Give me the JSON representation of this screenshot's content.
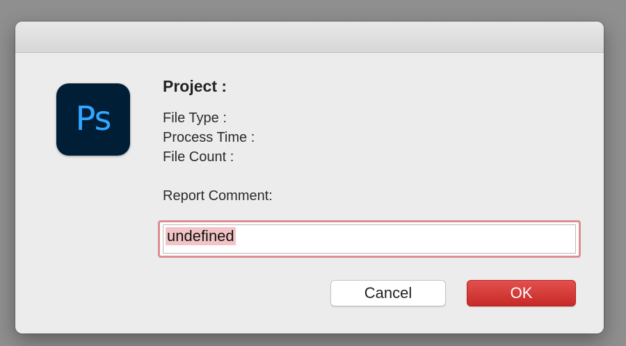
{
  "app": {
    "icon_name": "photoshop-app-icon",
    "icon_text": "Ps",
    "icon_bg": "#001e36",
    "icon_fg": "#31a8ff"
  },
  "dialog": {
    "title": "Project :",
    "file_type_label": "File Type :",
    "process_time_label": "Process Time :",
    "file_count_label": "File Count :",
    "report_comment_label": "Report Comment:"
  },
  "comment_input": {
    "value": "undefined",
    "focus_color": "#df8c92",
    "selection_color": "#f2c4c8"
  },
  "buttons": {
    "cancel_label": "Cancel",
    "ok_label": "OK",
    "ok_color": "#d4393a"
  }
}
